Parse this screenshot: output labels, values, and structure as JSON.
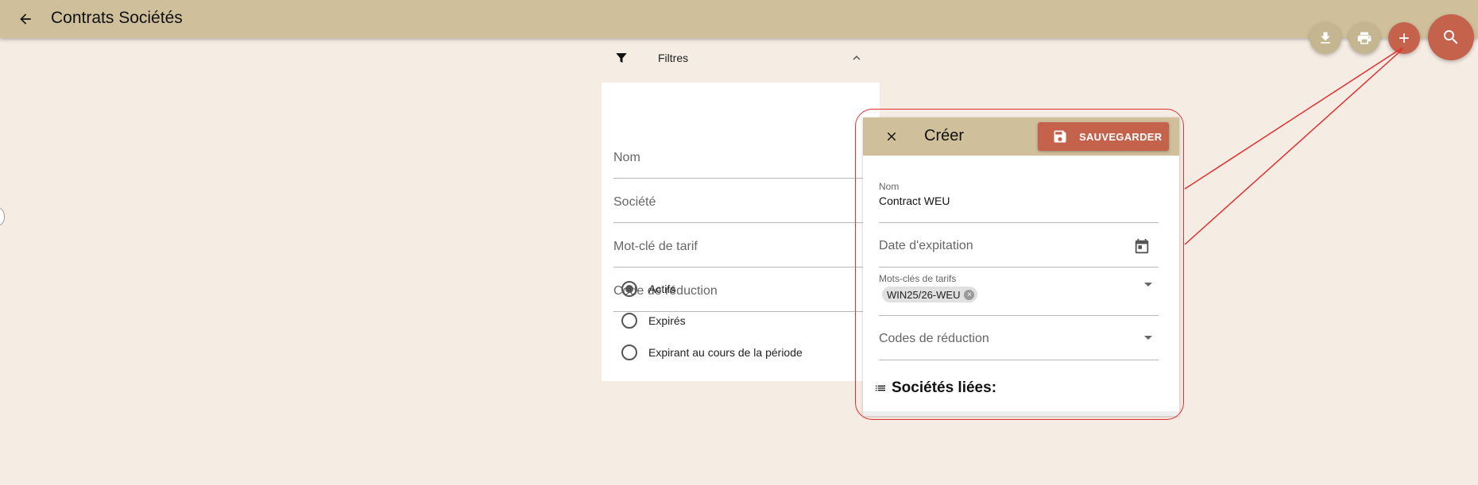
{
  "app": {
    "title": "Contrats Sociétés"
  },
  "icons": {
    "back": "arrow-left-icon",
    "download": "download-icon",
    "print": "print-icon",
    "add": "plus-icon",
    "search": "search-icon",
    "filter": "funnel-icon",
    "collapse": "chevron-up-icon",
    "close": "close-icon",
    "save": "floppy-disk-icon",
    "calendar": "calendar-icon",
    "list": "list-icon",
    "chip_remove": "circle-x-icon"
  },
  "colors": {
    "appbar": "#cfbf9a",
    "background": "#f5ece3",
    "accent": "#c5624c",
    "fab_secondary": "#c4b691",
    "annotation": "#e03030"
  },
  "filters": {
    "label": "Filtres",
    "fields": [
      {
        "label": "Nom"
      },
      {
        "label": "Société"
      },
      {
        "label": "Mot-clé de tarif"
      },
      {
        "label": "Code de réduction"
      }
    ],
    "status_options": [
      {
        "label": "Actifs",
        "checked": true
      },
      {
        "label": "Expirés",
        "checked": false
      },
      {
        "label": "Expirant au cours de la période",
        "checked": false
      }
    ]
  },
  "create_panel": {
    "title": "Créer",
    "save_label": "SAUVEGARDER",
    "name": {
      "label": "Nom",
      "value": "Contract WEU"
    },
    "expiry": {
      "label": "Date d'expitation"
    },
    "tariff_keywords": {
      "label": "Mots-clés de tarifs",
      "chips": [
        "WIN25/26-WEU"
      ]
    },
    "discount_codes": {
      "label": "Codes de réduction"
    },
    "linked_companies": {
      "title": "Sociétés liées:"
    }
  }
}
